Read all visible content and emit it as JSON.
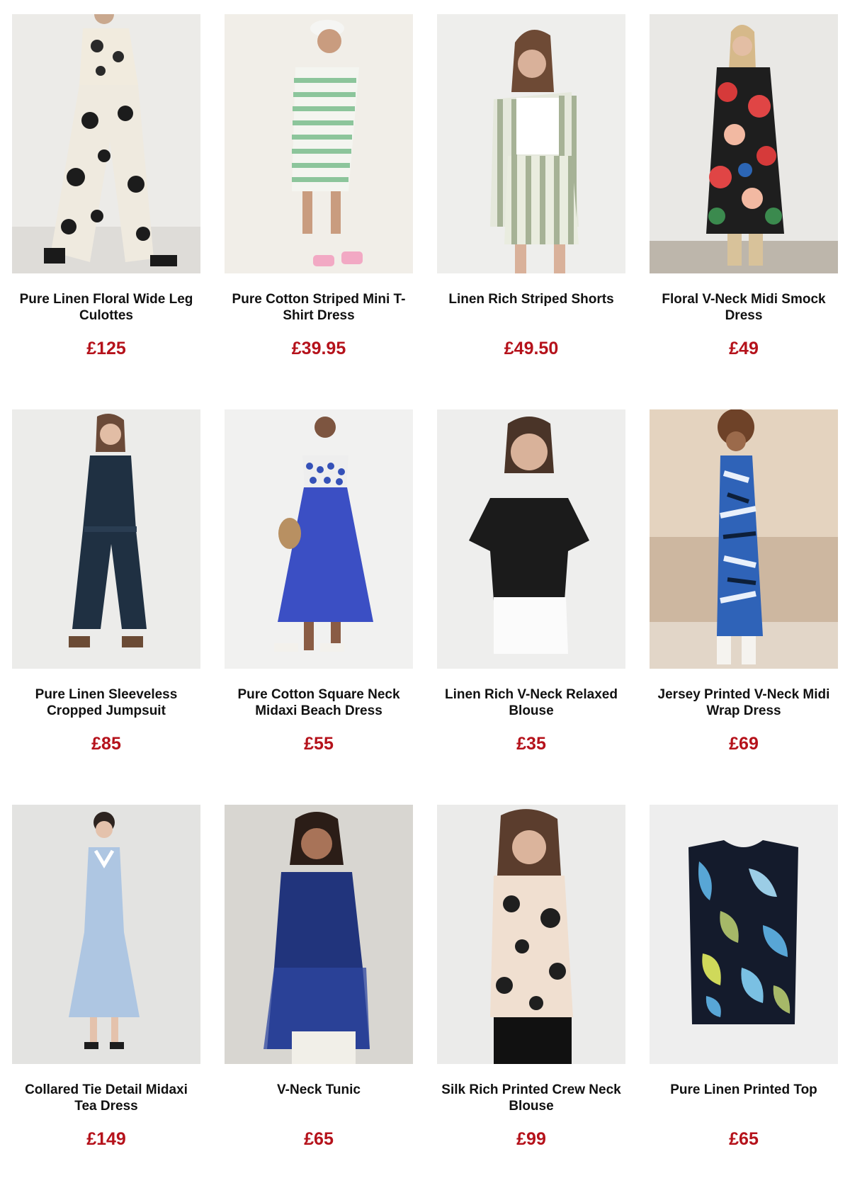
{
  "colors": {
    "price": "#b5121b",
    "title": "#111111",
    "background": "#ffffff"
  },
  "products": [
    {
      "title": "Pure Linen Floral Wide Leg Culottes",
      "price": "£125",
      "image": "model-black-cream-floral-culottes"
    },
    {
      "title": "Pure Cotton Striped Mini T-Shirt Dress",
      "price": "£39.95",
      "image": "model-green-striped-tshirt-dress"
    },
    {
      "title": "Linen Rich Striped Shorts",
      "price": "£49.50",
      "image": "model-sage-striped-shorts"
    },
    {
      "title": "Floral V-Neck Midi Smock Dress",
      "price": "£49",
      "image": "model-red-floral-smock-dress"
    },
    {
      "title": "Pure Linen Sleeveless Cropped Jumpsuit",
      "price": "£85",
      "image": "model-navy-linen-jumpsuit"
    },
    {
      "title": "Pure Cotton Square Neck Midaxi Beach Dress",
      "price": "£55",
      "image": "model-blue-beach-dress"
    },
    {
      "title": "Linen Rich V-Neck Relaxed Blouse",
      "price": "£35",
      "image": "model-black-linen-blouse"
    },
    {
      "title": "Jersey Printed V-Neck Midi Wrap Dress",
      "price": "£69",
      "image": "model-blue-printed-wrap-dress"
    },
    {
      "title": "Collared Tie Detail Midaxi Tea Dress",
      "price": "£149",
      "image": "model-pale-blue-tea-dress"
    },
    {
      "title": "V-Neck Tunic",
      "price": "£65",
      "image": "model-navy-vneck-tunic"
    },
    {
      "title": "Silk Rich Printed Crew Neck Blouse",
      "price": "£99",
      "image": "model-printed-silk-blouse"
    },
    {
      "title": "Pure Linen Printed Top",
      "price": "£65",
      "image": "product-printed-linen-top"
    }
  ]
}
